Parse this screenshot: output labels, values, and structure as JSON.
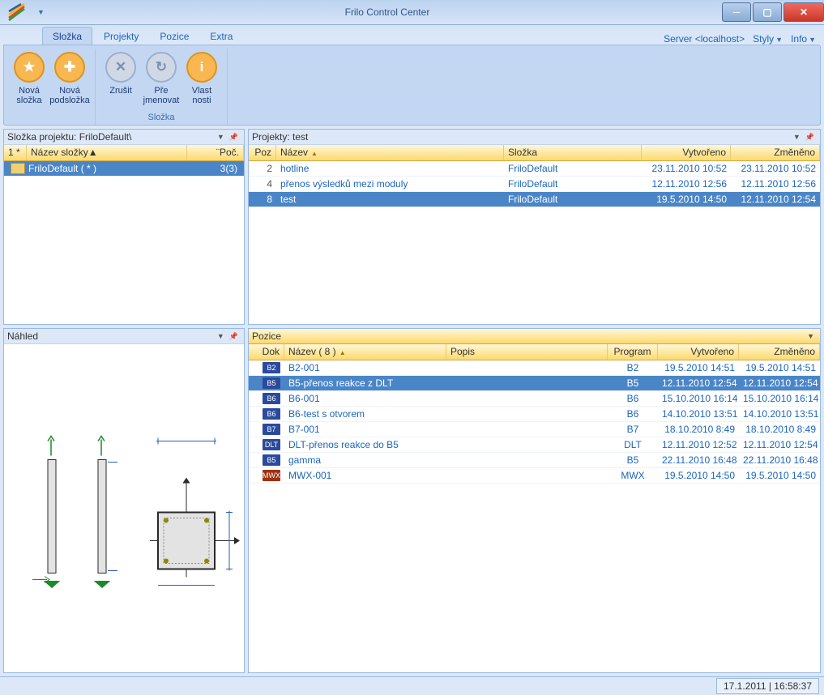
{
  "title": "Frilo Control Center",
  "tabs": {
    "t0": "Složka",
    "t1": "Projekty",
    "t2": "Pozice",
    "t3": "Extra"
  },
  "rightlinks": {
    "server": "Server <localhost>",
    "styly": "Styly",
    "info": "Info"
  },
  "ribbon": {
    "group": "Složka",
    "b0": {
      "l1": "Nová",
      "l2": "složka",
      "g": "★"
    },
    "b1": {
      "l1": "Nová",
      "l2": "podsložka",
      "g": "✚"
    },
    "b2": {
      "l1": "Zrušit",
      "l2": "",
      "g": "✕"
    },
    "b3": {
      "l1": "Pře",
      "l2": "jmenovat",
      "g": "↻"
    },
    "b4": {
      "l1": "Vlast",
      "l2": "nosti",
      "g": "i"
    }
  },
  "tree": {
    "title": "Složka projektu: FriloDefault\\",
    "col_idx": "1  *",
    "col_name": "Název složky",
    "col_cnt": "¨Poč.",
    "row_name": "FriloDefault  ( * )",
    "row_cnt": "3(3)"
  },
  "preview": {
    "title": "Náhled"
  },
  "projects": {
    "title": "Projekty: test",
    "cols": {
      "poz": "Poz",
      "nazev": "Název",
      "slozka": "Složka",
      "vytvoreno": "Vytvořeno",
      "zmeneno": "Změněno"
    },
    "rows": [
      {
        "poz": "2",
        "naz": "hotline",
        "slo": "FriloDefault",
        "vy": "23.11.2010 10:52",
        "zm": "23.11.2010 10:52",
        "sel": false
      },
      {
        "poz": "4",
        "naz": "přenos výsledků mezi moduly",
        "slo": "FriloDefault",
        "vy": "12.11.2010 12:56",
        "zm": "12.11.2010 12:56",
        "sel": false
      },
      {
        "poz": "8",
        "naz": "test",
        "slo": "FriloDefault",
        "vy": "19.5.2010 14:50",
        "zm": "12.11.2010 12:54",
        "sel": true
      }
    ]
  },
  "positions": {
    "title": "Pozice",
    "cols": {
      "dok": "Dok",
      "nazev": "Název  ( 8 )",
      "popis": "Popis",
      "program": "Program",
      "vytvoreno": "Vytvořeno",
      "zmeneno": "Změněno"
    },
    "rows": [
      {
        "dok": "B2",
        "col": "#2b4a9b",
        "naz": "B2-001",
        "prg": "B2",
        "vy": "19.5.2010 14:51",
        "zm": "19.5.2010 14:51",
        "sel": false
      },
      {
        "dok": "B5",
        "col": "#2b4a9b",
        "naz": "B5-přenos reakce z DLT",
        "prg": "B5",
        "vy": "12.11.2010 12:54",
        "zm": "12.11.2010 12:54",
        "sel": true
      },
      {
        "dok": "B6",
        "col": "#2b4a9b",
        "naz": "B6-001",
        "prg": "B6",
        "vy": "15.10.2010 16:14",
        "zm": "15.10.2010 16:14",
        "sel": false
      },
      {
        "dok": "B6",
        "col": "#2b4a9b",
        "naz": "B6-test s otvorem",
        "prg": "B6",
        "vy": "14.10.2010 13:51",
        "zm": "14.10.2010 13:51",
        "sel": false
      },
      {
        "dok": "B7",
        "col": "#2b4a9b",
        "naz": "B7-001",
        "prg": "B7",
        "vy": "18.10.2010 8:49",
        "zm": "18.10.2010 8:49",
        "sel": false
      },
      {
        "dok": "DLT",
        "col": "#2b4a9b",
        "naz": "DLT-přenos reakce do B5",
        "prg": "DLT",
        "vy": "12.11.2010 12:52",
        "zm": "12.11.2010 12:54",
        "sel": false
      },
      {
        "dok": "B5",
        "col": "#2b4a9b",
        "naz": "gamma",
        "prg": "B5",
        "vy": "22.11.2010 16:48",
        "zm": "22.11.2010 16:48",
        "sel": false
      },
      {
        "dok": "MWX",
        "col": "#a03010",
        "naz": "MWX-001",
        "prg": "MWX",
        "vy": "19.5.2010 14:50",
        "zm": "19.5.2010 14:50",
        "sel": false
      }
    ]
  },
  "status": {
    "datetime": "17.1.2011 | 16:58:37"
  }
}
